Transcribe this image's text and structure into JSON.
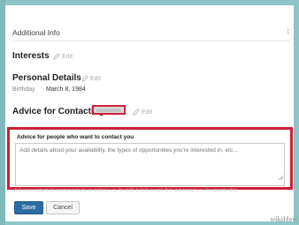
{
  "section": {
    "title": "Additional Info",
    "collapse_icon": "collapse-icon"
  },
  "interests": {
    "heading": "Interests",
    "edit_label": "Edit"
  },
  "personal_details": {
    "heading": "Personal Details",
    "edit_label": "Edit",
    "birthday_label": "Birthday",
    "birthday_value": "March 8, 1984"
  },
  "advice": {
    "heading": "Advice for Contacting",
    "edit_label": "Edit",
    "field_label": "Advice for people who want to contact you",
    "placeholder": "Add details about your availability, the types of opportunities you're interested in, etc...",
    "hint": "Ask your contacts to recommend you or endorse you for skills to help people find and contact you for opportunities"
  },
  "buttons": {
    "save_label": "Save",
    "cancel_label": "Cancel"
  },
  "watermark": "wikiHow",
  "colors": {
    "highlight": "#d02037",
    "primary": "#2d6ca2",
    "backdrop": "#8ec5c7"
  }
}
